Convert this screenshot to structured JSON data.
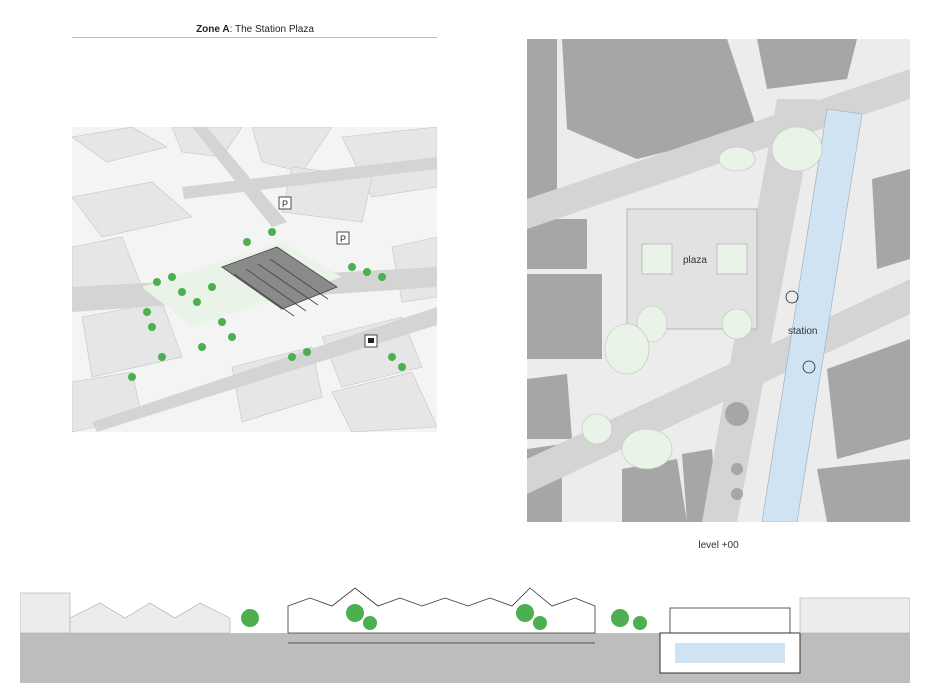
{
  "header": {
    "zone": "Zone A",
    "subtitle": ": The Station Plaza"
  },
  "plan": {
    "plaza_label": "plaza",
    "station_label": "station",
    "caption": "level +00"
  },
  "colors": {
    "building": "#a6a6a6",
    "road": "#d4d4d4",
    "ground": "#ececec",
    "tree": "#4caf50",
    "water": "#cfe3f2",
    "section_ground": "#bdbdbd"
  },
  "icons": [
    "parking-icon",
    "train-icon"
  ]
}
